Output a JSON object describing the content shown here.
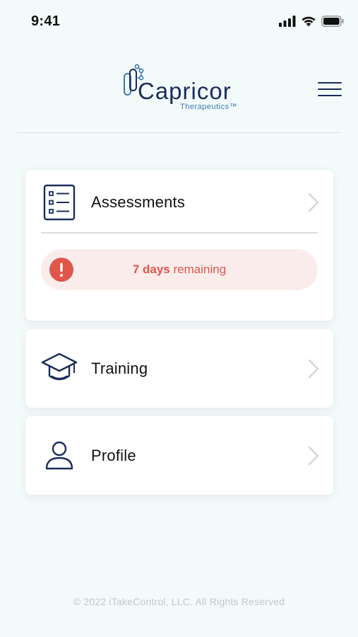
{
  "status_bar": {
    "time": "9:41",
    "icons": [
      "cellular-signal-icon",
      "wifi-icon",
      "battery-icon"
    ]
  },
  "header": {
    "logo_name": "Capricor",
    "logo_subtitle": "Therapeutics™",
    "menu_icon": "hamburger-menu-icon"
  },
  "menu": {
    "items": [
      {
        "label": "Assessments",
        "icon": "checklist-icon",
        "alert": {
          "icon": "exclamation-icon",
          "bold": "7 days",
          "text": "remaining",
          "color": "#e0564a",
          "background": "#fbecec"
        }
      },
      {
        "label": "Training",
        "icon": "graduation-cap-icon"
      },
      {
        "label": "Profile",
        "icon": "user-icon"
      }
    ]
  },
  "footer": {
    "copyright": "© 2022 iTakeControl, LLC.  All Rights Reserved"
  },
  "colors": {
    "brand_navy": "#1b2d5b",
    "brand_blue": "#3b78b6",
    "background": "#f3fafa",
    "alert_red": "#e0564a"
  }
}
